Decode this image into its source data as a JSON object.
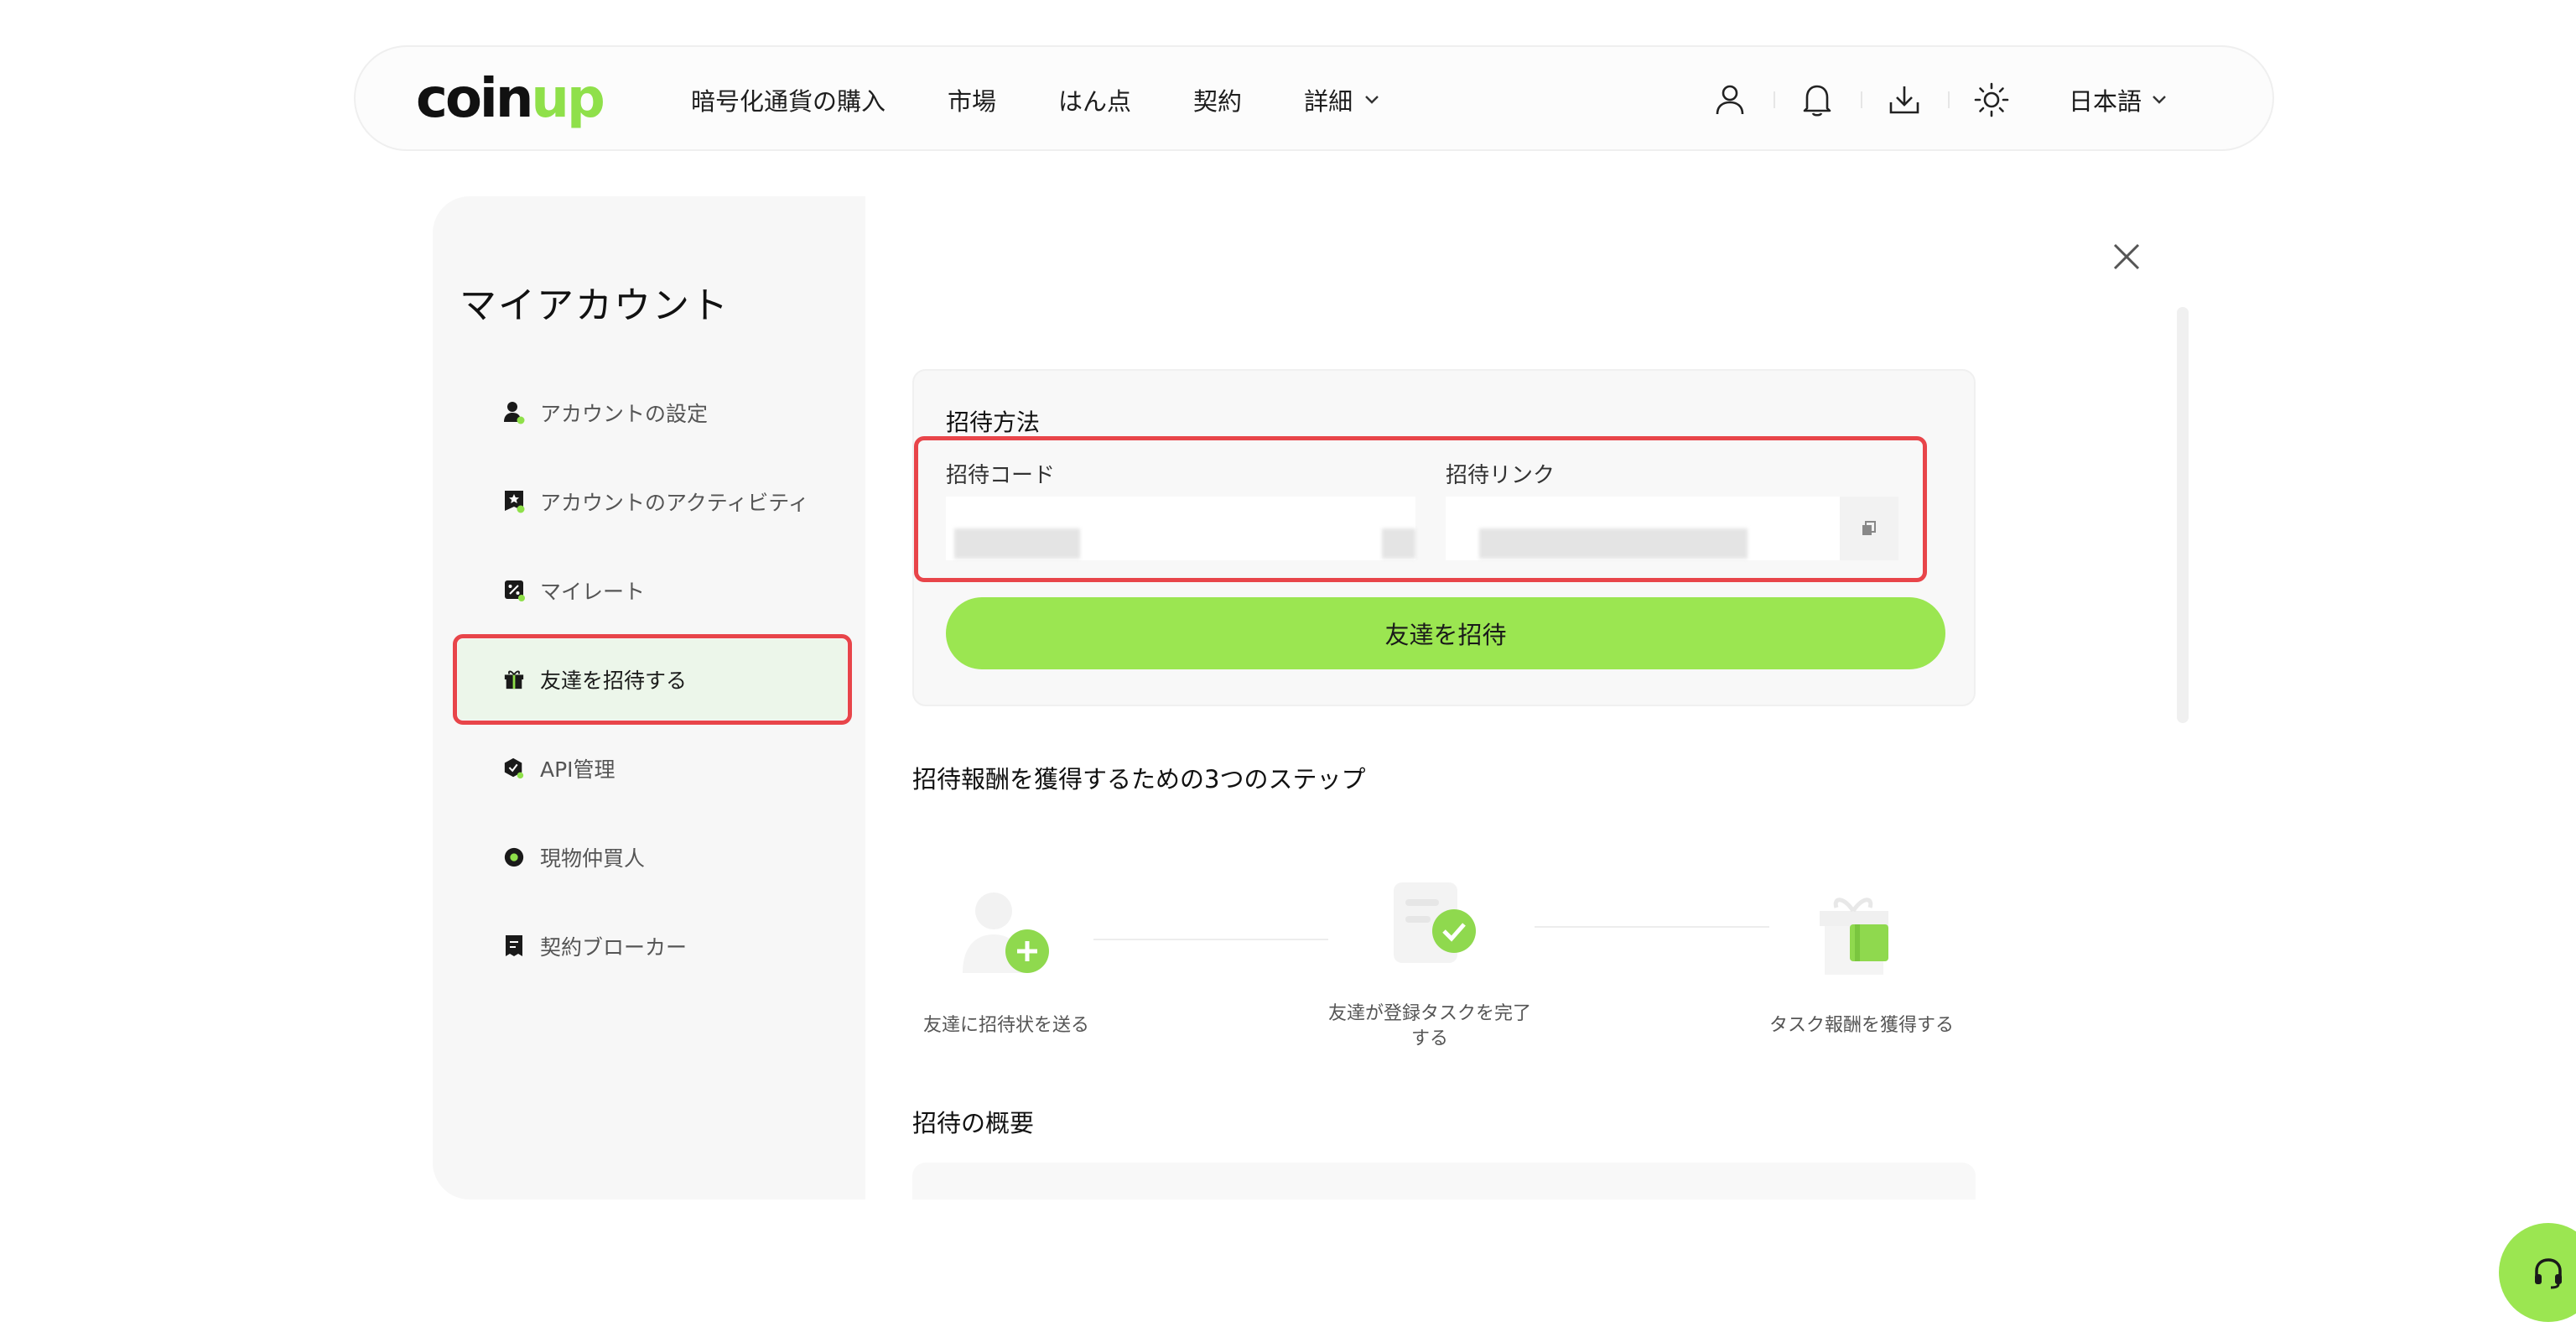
{
  "brand": {
    "logo_main": "coin",
    "logo_accent": "up",
    "accent_color": "#9be651"
  },
  "nav": {
    "items": [
      {
        "label": "暗号化通貨の購入"
      },
      {
        "label": "市場"
      },
      {
        "label": "はん点"
      },
      {
        "label": "契約"
      },
      {
        "label": "詳細"
      }
    ],
    "icons": [
      "user-icon",
      "bell-icon",
      "download-icon",
      "sun-icon"
    ],
    "language": "日本語"
  },
  "sidebar": {
    "title": "マイアカウント",
    "items": [
      {
        "label": "アカウントの設定",
        "icon": "user-settings-icon"
      },
      {
        "label": "アカウントのアクティビティ",
        "icon": "activity-icon"
      },
      {
        "label": "マイレート",
        "icon": "rate-icon"
      },
      {
        "label": "友達を招待する",
        "icon": "gift-icon",
        "active": true
      },
      {
        "label": "API管理",
        "icon": "api-icon"
      },
      {
        "label": "現物仲買人",
        "icon": "spot-broker-icon"
      },
      {
        "label": "契約ブローカー",
        "icon": "contract-broker-icon"
      }
    ]
  },
  "invite": {
    "title": "招待方法",
    "code_label": "招待コード",
    "link_label": "招待リンク",
    "button_label": "友達を招待"
  },
  "steps": {
    "title": "招待報酬を獲得するための3つのステップ",
    "items": [
      {
        "label": "友達に招待状を送る"
      },
      {
        "label": "友達が登録タスクを完了する"
      },
      {
        "label": "タスク報酬を獲得する"
      }
    ]
  },
  "overview": {
    "title": "招待の概要"
  },
  "highlight_color": "#e8454a"
}
